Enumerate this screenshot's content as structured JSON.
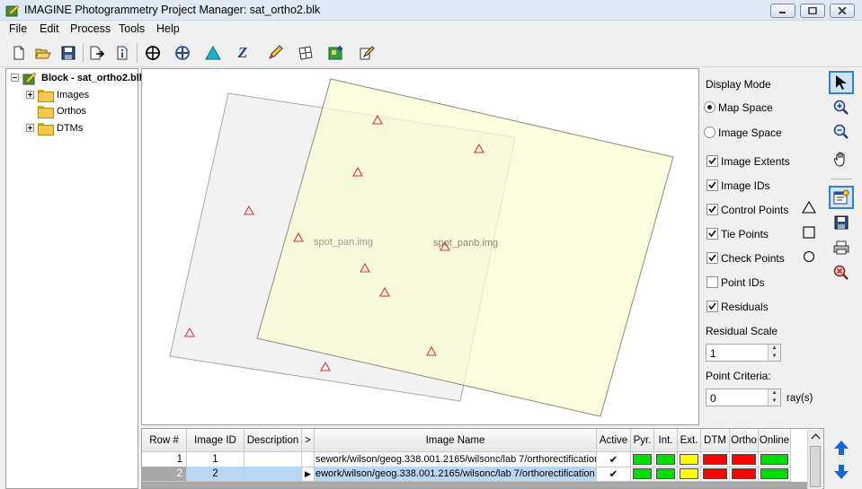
{
  "window": {
    "title": "IMAGINE Photogrammetry Project Manager: sat_ortho2.blk"
  },
  "menu": [
    "File",
    "Edit",
    "Process",
    "Tools",
    "Help"
  ],
  "toolbar": {
    "buttons": [
      "new-icon",
      "open-icon",
      "save-icon",
      "import-icon",
      "info-icon",
      "crosshair-icon",
      "point-measure-icon",
      "triangle-icon",
      "z-icon",
      "pencil-icon",
      "grid-icon",
      "ortho-icon",
      "edit-icon"
    ],
    "z_label": "Z"
  },
  "tree": {
    "root": "Block - sat_ortho2.blk",
    "children": [
      "Images",
      "Orthos",
      "DTMs"
    ]
  },
  "map": {
    "image1_label": "spot_pan.img",
    "image2_label": "spot_panb.img",
    "colors": {
      "image1_fill": "#f0f0f0",
      "image2_fill": "#fafad2",
      "point_color": "#e03030"
    }
  },
  "display": {
    "mode_label": "Display Mode",
    "map_space": "Map Space",
    "image_space": "Image Space",
    "mode": "map",
    "image_extents": "Image Extents",
    "image_ids": "Image IDs",
    "control_points": "Control Points",
    "tie_points": "Tie Points",
    "check_points": "Check Points",
    "point_ids": "Point IDs",
    "residuals": "Residuals",
    "residual_scale_label": "Residual Scale",
    "residual_scale": "1",
    "point_criteria_label": "Point Criteria:",
    "point_criteria": "0",
    "rays_label": "ray(s)",
    "checks": {
      "image_extents": true,
      "image_ids": true,
      "control_points": true,
      "tie_points": true,
      "check_points": true,
      "point_ids": false,
      "residuals": true
    }
  },
  "table": {
    "headers": [
      "Row #",
      "Image ID",
      "Description",
      ">",
      "Image Name",
      "Active",
      "Pyr.",
      "Int.",
      "Ext.",
      "DTM",
      "Ortho",
      "Online"
    ],
    "rows": [
      {
        "row": "1",
        "id": "1",
        "desc": "",
        "marker": "",
        "name": "sework/wilson/geog.338.001.2165/wilsonc/lab 7/orthorectification",
        "active": "✔",
        "status": [
          "green",
          "green",
          "yellow",
          "red",
          "red",
          "green"
        ]
      },
      {
        "row": "2",
        "id": "2",
        "desc": "",
        "marker": "▶",
        "name": "ework/wilson/geog.338.001.2165/wilsonc/lab 7/orthorectification",
        "active": "✔",
        "status": [
          "green",
          "green",
          "yellow",
          "red",
          "red",
          "green"
        ]
      }
    ]
  }
}
